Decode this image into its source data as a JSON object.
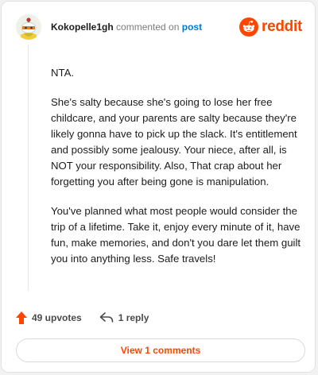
{
  "header": {
    "username": "Kokopelle1gh",
    "action_text": "commented on",
    "post_link": "post",
    "logo_text": "reddit"
  },
  "comment": {
    "paragraphs": [
      "NTA.",
      "She's salty because she's going to lose her free childcare, and your parents are salty because they're likely gonna have to pick up the slack. It's entitlement and possibly some jealousy. Your niece, after all, is NOT your responsibility. Also, That crap about her forgetting you after being gone is manipulation.",
      "You've planned what most people would consider the trip of a lifetime. Take it, enjoy every minute of it, have fun, make memories, and don't you dare let them guilt you into anything less. Safe travels!"
    ]
  },
  "actions": {
    "upvotes_label": "49 upvotes",
    "reply_label": "1 reply"
  },
  "footer": {
    "view_comments_label": "View 1 comments"
  },
  "icons": {
    "upvote": "upvote-arrow-icon",
    "reply": "reply-arrow-icon",
    "logo": "reddit-snoo-icon",
    "avatar": "snoo-avatar-icon"
  },
  "colors": {
    "brand": "#ff4500",
    "link": "#0079d3",
    "text": "#1c1c1c",
    "muted": "#7c7c7c"
  }
}
